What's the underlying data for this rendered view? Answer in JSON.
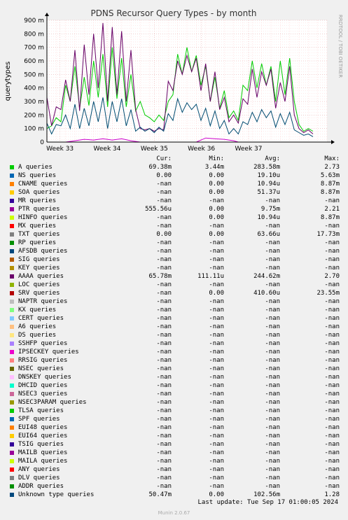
{
  "chart_data": {
    "type": "line",
    "title": "PDNS Recursor Query Types - by month",
    "ylabel": "querytypes",
    "side_label": "RRDTOOL / TOBI OETIKER",
    "ylim": [
      0,
      900
    ],
    "y_ticks": [
      "0",
      "100 m",
      "200 m",
      "300 m",
      "400 m",
      "500 m",
      "600 m",
      "700 m",
      "800 m",
      "900 m"
    ],
    "x_ticks": [
      "Week 33",
      "Week 34",
      "Week 35",
      "Week 36",
      "Week 37"
    ],
    "x_range": [
      0,
      30
    ],
    "x_tick_positions": [
      1.4,
      6.45,
      11.5,
      16.55,
      21.6
    ],
    "grid": true,
    "series": [
      {
        "name": "A queries",
        "color": "#00cc00",
        "points": [
          [
            0,
            100
          ],
          [
            0.5,
            120
          ],
          [
            1,
            180
          ],
          [
            1.5,
            150
          ],
          [
            2,
            420
          ],
          [
            2.5,
            300
          ],
          [
            3,
            560
          ],
          [
            3.5,
            250
          ],
          [
            4,
            480
          ],
          [
            4.5,
            270
          ],
          [
            5,
            600
          ],
          [
            5.5,
            330
          ],
          [
            6,
            650
          ],
          [
            6.5,
            260
          ],
          [
            7,
            700
          ],
          [
            7.5,
            320
          ],
          [
            8,
            620
          ],
          [
            8.5,
            260
          ],
          [
            9,
            500
          ],
          [
            9.5,
            230
          ],
          [
            10,
            300
          ],
          [
            10.5,
            200
          ],
          [
            11,
            180
          ],
          [
            11.5,
            150
          ],
          [
            12,
            200
          ],
          [
            12.5,
            160
          ],
          [
            13,
            300
          ],
          [
            13.5,
            350
          ],
          [
            14,
            650
          ],
          [
            14.5,
            500
          ],
          [
            15,
            700
          ],
          [
            15.5,
            520
          ],
          [
            16,
            640
          ],
          [
            16.5,
            420
          ],
          [
            17,
            560
          ],
          [
            17.5,
            300
          ],
          [
            18,
            480
          ],
          [
            18.5,
            250
          ],
          [
            19,
            380
          ],
          [
            19.5,
            180
          ],
          [
            20,
            230
          ],
          [
            20.5,
            160
          ],
          [
            21,
            420
          ],
          [
            21.5,
            380
          ],
          [
            22,
            600
          ],
          [
            22.5,
            400
          ],
          [
            23,
            580
          ],
          [
            23.5,
            420
          ],
          [
            24,
            560
          ],
          [
            24.5,
            300
          ],
          [
            25,
            600
          ],
          [
            25.5,
            350
          ],
          [
            26,
            620
          ],
          [
            26.5,
            300
          ],
          [
            27,
            130
          ],
          [
            27.5,
            80
          ],
          [
            28,
            100
          ],
          [
            28.5,
            80
          ]
        ]
      },
      {
        "name": "PTR queries",
        "color": "#cc00cc",
        "points": [
          [
            0,
            0
          ],
          [
            2,
            0
          ],
          [
            3,
            10
          ],
          [
            4,
            20
          ],
          [
            5,
            15
          ],
          [
            6,
            25
          ],
          [
            7,
            15
          ],
          [
            8,
            25
          ],
          [
            9,
            10
          ],
          [
            10,
            0
          ],
          [
            12,
            0
          ],
          [
            14,
            0
          ],
          [
            16,
            0
          ],
          [
            17,
            30
          ],
          [
            18,
            25
          ],
          [
            19,
            20
          ],
          [
            20,
            10
          ],
          [
            20.5,
            0
          ],
          [
            22,
            0
          ],
          [
            28.5,
            0
          ]
        ]
      },
      {
        "name": "AAAA queries",
        "color": "#660066",
        "points": [
          [
            0,
            330
          ],
          [
            0.5,
            120
          ],
          [
            1,
            260
          ],
          [
            1.5,
            240
          ],
          [
            2,
            460
          ],
          [
            2.5,
            300
          ],
          [
            3,
            680
          ],
          [
            3.5,
            230
          ],
          [
            4,
            720
          ],
          [
            4.5,
            350
          ],
          [
            5,
            800
          ],
          [
            5.5,
            400
          ],
          [
            6,
            880
          ],
          [
            6.5,
            300
          ],
          [
            7,
            850
          ],
          [
            7.5,
            350
          ],
          [
            8,
            820
          ],
          [
            8.5,
            300
          ],
          [
            9,
            680
          ],
          [
            9.5,
            240
          ],
          [
            10,
            100
          ],
          [
            10.5,
            90
          ],
          [
            11,
            100
          ],
          [
            11.5,
            80
          ],
          [
            12,
            100
          ],
          [
            12.5,
            90
          ],
          [
            13,
            450
          ],
          [
            13.5,
            380
          ],
          [
            14,
            600
          ],
          [
            14.5,
            500
          ],
          [
            15,
            640
          ],
          [
            15.5,
            520
          ],
          [
            16,
            620
          ],
          [
            16.5,
            380
          ],
          [
            17,
            580
          ],
          [
            17.5,
            300
          ],
          [
            18,
            520
          ],
          [
            18.5,
            240
          ],
          [
            19,
            330
          ],
          [
            19.5,
            150
          ],
          [
            20,
            200
          ],
          [
            20.5,
            140
          ],
          [
            21,
            320
          ],
          [
            21.5,
            280
          ],
          [
            22,
            540
          ],
          [
            22.5,
            330
          ],
          [
            23,
            520
          ],
          [
            23.5,
            420
          ],
          [
            24,
            540
          ],
          [
            24.5,
            250
          ],
          [
            25,
            440
          ],
          [
            25.5,
            300
          ],
          [
            26,
            560
          ],
          [
            26.5,
            200
          ],
          [
            27,
            100
          ],
          [
            27.5,
            70
          ],
          [
            28,
            90
          ],
          [
            28.5,
            60
          ]
        ]
      },
      {
        "name": "Unknown type queries",
        "color": "#004b71",
        "points": [
          [
            0,
            140
          ],
          [
            0.5,
            60
          ],
          [
            1,
            130
          ],
          [
            1.5,
            120
          ],
          [
            2,
            200
          ],
          [
            2.5,
            100
          ],
          [
            3,
            280
          ],
          [
            3.5,
            100
          ],
          [
            4,
            250
          ],
          [
            4.5,
            120
          ],
          [
            5,
            300
          ],
          [
            5.5,
            150
          ],
          [
            6,
            330
          ],
          [
            6.5,
            100
          ],
          [
            7,
            300
          ],
          [
            7.5,
            150
          ],
          [
            8,
            320
          ],
          [
            8.5,
            120
          ],
          [
            9,
            240
          ],
          [
            9.5,
            80
          ],
          [
            10,
            110
          ],
          [
            10.5,
            80
          ],
          [
            11,
            100
          ],
          [
            11.5,
            70
          ],
          [
            12,
            110
          ],
          [
            12.5,
            80
          ],
          [
            13,
            210
          ],
          [
            13.5,
            160
          ],
          [
            14,
            320
          ],
          [
            14.5,
            220
          ],
          [
            15,
            290
          ],
          [
            15.5,
            240
          ],
          [
            16,
            280
          ],
          [
            16.5,
            160
          ],
          [
            17,
            250
          ],
          [
            17.5,
            120
          ],
          [
            18,
            230
          ],
          [
            18.5,
            100
          ],
          [
            19,
            160
          ],
          [
            19.5,
            60
          ],
          [
            20,
            100
          ],
          [
            20.5,
            60
          ],
          [
            21,
            150
          ],
          [
            21.5,
            130
          ],
          [
            22,
            220
          ],
          [
            22.5,
            150
          ],
          [
            23,
            240
          ],
          [
            23.5,
            180
          ],
          [
            24,
            230
          ],
          [
            24.5,
            110
          ],
          [
            25,
            210
          ],
          [
            25.5,
            130
          ],
          [
            26,
            220
          ],
          [
            26.5,
            90
          ],
          [
            27,
            70
          ],
          [
            27.5,
            50
          ],
          [
            28,
            60
          ],
          [
            28.5,
            40
          ]
        ]
      }
    ]
  },
  "legend": {
    "headers": {
      "cur": "Cur:",
      "min": "Min:",
      "avg": "Avg:",
      "max": "Max:"
    },
    "rows": [
      {
        "name": "A queries",
        "color": "#00cc00",
        "cur": "69.38m",
        "min": "3.44m",
        "avg": "283.58m",
        "max": "2.73"
      },
      {
        "name": "NS queries",
        "color": "#0066b3",
        "cur": "0.00",
        "min": "0.00",
        "avg": "19.10u",
        "max": "5.63m"
      },
      {
        "name": "CNAME queries",
        "color": "#ff8000",
        "cur": "-nan",
        "min": "0.00",
        "avg": "10.94u",
        "max": "8.87m"
      },
      {
        "name": "SOA queries",
        "color": "#ffcc00",
        "cur": "-nan",
        "min": "0.00",
        "avg": "51.37u",
        "max": "8.87m"
      },
      {
        "name": "MR queries",
        "color": "#330099",
        "cur": "-nan",
        "min": "-nan",
        "avg": "-nan",
        "max": "-nan"
      },
      {
        "name": "PTR queries",
        "color": "#990099",
        "cur": "555.56u",
        "min": "0.00",
        "avg": "9.75m",
        "max": "2.21"
      },
      {
        "name": "HINFO queries",
        "color": "#ccff00",
        "cur": "-nan",
        "min": "0.00",
        "avg": "10.94u",
        "max": "8.87m"
      },
      {
        "name": "MX queries",
        "color": "#ff0000",
        "cur": "-nan",
        "min": "-nan",
        "avg": "-nan",
        "max": "-nan"
      },
      {
        "name": "TXT queries",
        "color": "#808080",
        "cur": "0.00",
        "min": "0.00",
        "avg": "63.66u",
        "max": "17.73m"
      },
      {
        "name": "RP queries",
        "color": "#008f00",
        "cur": "-nan",
        "min": "-nan",
        "avg": "-nan",
        "max": "-nan"
      },
      {
        "name": "AFSDB queries",
        "color": "#00487d",
        "cur": "-nan",
        "min": "-nan",
        "avg": "-nan",
        "max": "-nan"
      },
      {
        "name": "SIG queries",
        "color": "#b35a00",
        "cur": "-nan",
        "min": "-nan",
        "avg": "-nan",
        "max": "-nan"
      },
      {
        "name": "KEY queries",
        "color": "#b38f00",
        "cur": "-nan",
        "min": "-nan",
        "avg": "-nan",
        "max": "-nan"
      },
      {
        "name": "AAAA queries",
        "color": "#6b006b",
        "cur": "65.78m",
        "min": "111.11u",
        "avg": "244.62m",
        "max": "2.70"
      },
      {
        "name": "LOC queries",
        "color": "#8fb300",
        "cur": "-nan",
        "min": "-nan",
        "avg": "-nan",
        "max": "-nan"
      },
      {
        "name": "SRV queries",
        "color": "#b30000",
        "cur": "-nan",
        "min": "0.00",
        "avg": "410.60u",
        "max": "23.55m"
      },
      {
        "name": "NAPTR queries",
        "color": "#bebebe",
        "cur": "-nan",
        "min": "-nan",
        "avg": "-nan",
        "max": "-nan"
      },
      {
        "name": "KX queries",
        "color": "#80ff80",
        "cur": "-nan",
        "min": "-nan",
        "avg": "-nan",
        "max": "-nan"
      },
      {
        "name": "CERT queries",
        "color": "#80c9ff",
        "cur": "-nan",
        "min": "-nan",
        "avg": "-nan",
        "max": "-nan"
      },
      {
        "name": "A6 queries",
        "color": "#ffc080",
        "cur": "-nan",
        "min": "-nan",
        "avg": "-nan",
        "max": "-nan"
      },
      {
        "name": "DS queries",
        "color": "#ffe680",
        "cur": "-nan",
        "min": "-nan",
        "avg": "-nan",
        "max": "-nan"
      },
      {
        "name": "SSHFP queries",
        "color": "#aa80ff",
        "cur": "-nan",
        "min": "-nan",
        "avg": "-nan",
        "max": "-nan"
      },
      {
        "name": "IPSECKEY queries",
        "color": "#ee00cc",
        "cur": "-nan",
        "min": "-nan",
        "avg": "-nan",
        "max": "-nan"
      },
      {
        "name": "RRSIG queries",
        "color": "#ff8080",
        "cur": "-nan",
        "min": "-nan",
        "avg": "-nan",
        "max": "-nan"
      },
      {
        "name": "NSEC queries",
        "color": "#666600",
        "cur": "-nan",
        "min": "-nan",
        "avg": "-nan",
        "max": "-nan"
      },
      {
        "name": "DNSKEY queries",
        "color": "#ffbfff",
        "cur": "-nan",
        "min": "-nan",
        "avg": "-nan",
        "max": "-nan"
      },
      {
        "name": "DHCID queries",
        "color": "#00ffcc",
        "cur": "-nan",
        "min": "-nan",
        "avg": "-nan",
        "max": "-nan"
      },
      {
        "name": "NSEC3 queries",
        "color": "#cc6699",
        "cur": "-nan",
        "min": "-nan",
        "avg": "-nan",
        "max": "-nan"
      },
      {
        "name": "NSEC3PARAM queries",
        "color": "#999900",
        "cur": "-nan",
        "min": "-nan",
        "avg": "-nan",
        "max": "-nan"
      },
      {
        "name": "TLSA queries",
        "color": "#00cc00",
        "cur": "-nan",
        "min": "-nan",
        "avg": "-nan",
        "max": "-nan"
      },
      {
        "name": "SPF queries",
        "color": "#0066b3",
        "cur": "-nan",
        "min": "-nan",
        "avg": "-nan",
        "max": "-nan"
      },
      {
        "name": "EUI48 queries",
        "color": "#ff8000",
        "cur": "-nan",
        "min": "-nan",
        "avg": "-nan",
        "max": "-nan"
      },
      {
        "name": "EUI64 queries",
        "color": "#ffcc00",
        "cur": "-nan",
        "min": "-nan",
        "avg": "-nan",
        "max": "-nan"
      },
      {
        "name": "TSIG queries",
        "color": "#330099",
        "cur": "-nan",
        "min": "-nan",
        "avg": "-nan",
        "max": "-nan"
      },
      {
        "name": "MAILB queries",
        "color": "#990099",
        "cur": "-nan",
        "min": "-nan",
        "avg": "-nan",
        "max": "-nan"
      },
      {
        "name": "MAILA queries",
        "color": "#ccff00",
        "cur": "-nan",
        "min": "-nan",
        "avg": "-nan",
        "max": "-nan"
      },
      {
        "name": "ANY queries",
        "color": "#ff0000",
        "cur": "-nan",
        "min": "-nan",
        "avg": "-nan",
        "max": "-nan"
      },
      {
        "name": "DLV queries",
        "color": "#808080",
        "cur": "-nan",
        "min": "-nan",
        "avg": "-nan",
        "max": "-nan"
      },
      {
        "name": "ADDR queries",
        "color": "#008f00",
        "cur": "-nan",
        "min": "-nan",
        "avg": "-nan",
        "max": "-nan"
      },
      {
        "name": "Unknown type queries",
        "color": "#00487d",
        "cur": "50.47m",
        "min": "0.00",
        "avg": "102.56m",
        "max": "1.28"
      }
    ]
  },
  "footer": {
    "last_update": "Last update: Tue Sep 17 01:00:05 2024",
    "munin_version": "Munin 2.0.67"
  }
}
